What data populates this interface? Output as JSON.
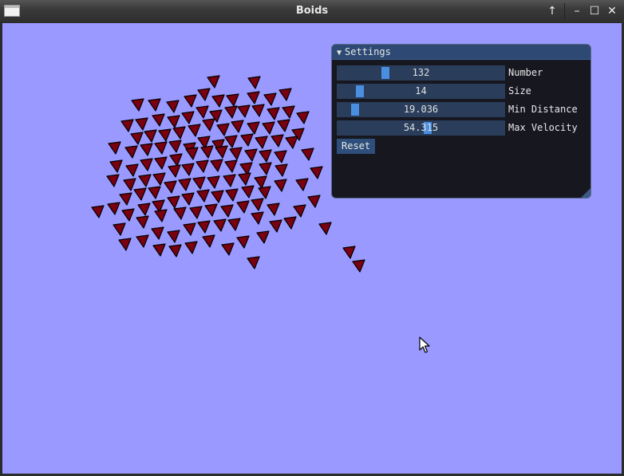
{
  "window": {
    "title": "Boids"
  },
  "window_buttons": [
    {
      "name": "keep-above-icon",
      "glyph": "↑"
    },
    {
      "name": "minimize-icon",
      "glyph": "–"
    },
    {
      "name": "maximize-icon",
      "glyph": "☐"
    },
    {
      "name": "close-icon",
      "glyph": "✕"
    }
  ],
  "colors": {
    "canvas": "#9999ff",
    "boid_fill": "#7a0010",
    "boid_stroke": "#000000"
  },
  "settings": {
    "title": "Settings",
    "collapse_arrow": "▼",
    "sliders": [
      {
        "label": "Number",
        "value": "132",
        "fraction": 0.28
      },
      {
        "label": "Size",
        "value": "14",
        "fraction": 0.12
      },
      {
        "label": "Min Distance",
        "value": "19.036",
        "fraction": 0.09
      },
      {
        "label": "Max Velocity",
        "value": "54.315",
        "fraction": 0.54
      }
    ],
    "reset_label": "Reset"
  },
  "boids": [
    [
      268,
      102,
      0
    ],
    [
      319,
      103,
      0
    ],
    [
      173,
      131,
      0
    ],
    [
      194,
      131,
      0
    ],
    [
      217,
      133,
      0
    ],
    [
      239,
      126,
      0
    ],
    [
      256,
      118,
      0
    ],
    [
      274,
      126,
      0
    ],
    [
      292,
      125,
      0
    ],
    [
      318,
      122,
      0
    ],
    [
      339,
      124,
      0
    ],
    [
      358,
      118,
      0
    ],
    [
      160,
      157,
      0
    ],
    [
      178,
      155,
      0
    ],
    [
      199,
      150,
      0
    ],
    [
      218,
      152,
      0
    ],
    [
      236,
      147,
      0
    ],
    [
      254,
      140,
      0
    ],
    [
      271,
      145,
      0
    ],
    [
      290,
      140,
      0
    ],
    [
      306,
      139,
      0
    ],
    [
      324,
      138,
      0
    ],
    [
      343,
      142,
      0
    ],
    [
      362,
      140,
      0
    ],
    [
      380,
      147,
      0
    ],
    [
      172,
      173,
      0
    ],
    [
      189,
      170,
      0
    ],
    [
      207,
      169,
      0
    ],
    [
      225,
      166,
      0
    ],
    [
      244,
      163,
      0
    ],
    [
      262,
      156,
      0
    ],
    [
      280,
      162,
      0
    ],
    [
      298,
      158,
      0
    ],
    [
      318,
      160,
      0
    ],
    [
      337,
      160,
      0
    ],
    [
      356,
      157,
      0
    ],
    [
      374,
      168,
      0
    ],
    [
      144,
      185,
      0
    ],
    [
      165,
      190,
      0
    ],
    [
      184,
      187,
      0
    ],
    [
      202,
      185,
      0
    ],
    [
      220,
      183,
      0
    ],
    [
      238,
      186,
      0
    ],
    [
      256,
      178,
      0
    ],
    [
      274,
      182,
      0
    ],
    [
      290,
      177,
      0
    ],
    [
      310,
      175,
      0
    ],
    [
      328,
      178,
      0
    ],
    [
      348,
      176,
      0
    ],
    [
      366,
      178,
      0
    ],
    [
      386,
      193,
      0
    ],
    [
      146,
      208,
      0
    ],
    [
      166,
      213,
      0
    ],
    [
      184,
      206,
      0
    ],
    [
      202,
      204,
      0
    ],
    [
      221,
      200,
      0
    ],
    [
      241,
      192,
      0
    ],
    [
      260,
      190,
      0
    ],
    [
      278,
      190,
      0
    ],
    [
      296,
      192,
      0
    ],
    [
      315,
      194,
      0
    ],
    [
      333,
      195,
      0
    ],
    [
      352,
      196,
      0
    ],
    [
      142,
      226,
      0
    ],
    [
      163,
      231,
      0
    ],
    [
      182,
      226,
      0
    ],
    [
      200,
      224,
      0
    ],
    [
      219,
      214,
      0
    ],
    [
      236,
      212,
      0
    ],
    [
      254,
      208,
      0
    ],
    [
      272,
      207,
      0
    ],
    [
      290,
      208,
      0
    ],
    [
      309,
      211,
      0
    ],
    [
      333,
      211,
      0
    ],
    [
      353,
      213,
      0
    ],
    [
      397,
      216,
      0
    ],
    [
      158,
      249,
      0
    ],
    [
      176,
      243,
      0
    ],
    [
      194,
      241,
      0
    ],
    [
      214,
      234,
      0
    ],
    [
      232,
      231,
      0
    ],
    [
      250,
      229,
      0
    ],
    [
      268,
      228,
      0
    ],
    [
      288,
      226,
      0
    ],
    [
      307,
      224,
      0
    ],
    [
      327,
      228,
      0
    ],
    [
      352,
      232,
      0
    ],
    [
      379,
      231,
      0
    ],
    [
      123,
      265,
      0
    ],
    [
      143,
      261,
      0
    ],
    [
      161,
      269,
      0
    ],
    [
      181,
      262,
      0
    ],
    [
      199,
      258,
      0
    ],
    [
      218,
      253,
      0
    ],
    [
      236,
      249,
      0
    ],
    [
      255,
      245,
      0
    ],
    [
      273,
      246,
      0
    ],
    [
      291,
      244,
      0
    ],
    [
      311,
      240,
      0
    ],
    [
      332,
      241,
      0
    ],
    [
      394,
      252,
      0
    ],
    [
      150,
      287,
      0
    ],
    [
      179,
      278,
      0
    ],
    [
      202,
      270,
      0
    ],
    [
      226,
      267,
      0
    ],
    [
      246,
      266,
      0
    ],
    [
      265,
      263,
      0
    ],
    [
      285,
      264,
      0
    ],
    [
      305,
      259,
      0
    ],
    [
      323,
      256,
      0
    ],
    [
      343,
      262,
      0
    ],
    [
      376,
      264,
      0
    ],
    [
      157,
      306,
      0
    ],
    [
      179,
      302,
      0
    ],
    [
      198,
      292,
      0
    ],
    [
      218,
      296,
      0
    ],
    [
      238,
      287,
      0
    ],
    [
      256,
      284,
      0
    ],
    [
      276,
      282,
      0
    ],
    [
      294,
      281,
      0
    ],
    [
      323,
      273,
      0
    ],
    [
      346,
      283,
      0
    ],
    [
      364,
      279,
      0
    ],
    [
      408,
      286,
      0
    ],
    [
      200,
      313,
      0
    ],
    [
      220,
      314,
      0
    ],
    [
      240,
      310,
      0
    ],
    [
      262,
      302,
      0
    ],
    [
      286,
      312,
      0
    ],
    [
      305,
      303,
      0
    ],
    [
      330,
      297,
      0
    ],
    [
      438,
      316,
      0
    ],
    [
      318,
      329,
      0
    ],
    [
      450,
      333,
      0
    ]
  ]
}
